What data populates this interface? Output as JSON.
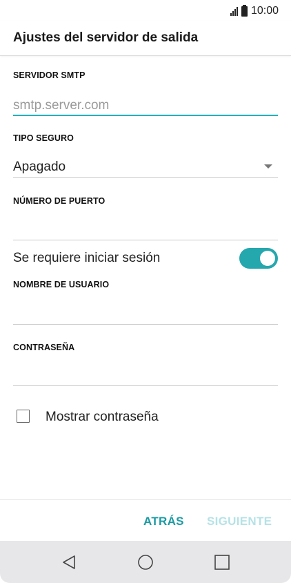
{
  "status_bar": {
    "time": "10:00"
  },
  "header": {
    "title": "Ajustes del servidor de salida"
  },
  "form": {
    "smtp_server": {
      "label": "SERVIDOR SMTP",
      "value": "",
      "placeholder": "smtp.server.com"
    },
    "security_type": {
      "label": "TIPO SEGURO",
      "value": "Apagado"
    },
    "port_number": {
      "label": "NÚMERO DE PUERTO",
      "value": ""
    },
    "login_required": {
      "label": "Se requiere iniciar sesión",
      "enabled": true
    },
    "username": {
      "label": "NOMBRE DE USUARIO",
      "value": ""
    },
    "password": {
      "label": "CONTRASEÑA",
      "value": ""
    },
    "show_password": {
      "label": "Mostrar contraseña",
      "checked": false
    }
  },
  "footer": {
    "back_label": "ATRÁS",
    "next_label": "SIGUIENTE"
  },
  "navigation": {
    "icons": [
      "back-icon",
      "home-icon",
      "recent-apps-icon"
    ]
  },
  "colors": {
    "accent": "#25a7ae",
    "accent_dark": "#1c9aa3",
    "disabled_text": "#b6e2e6",
    "nav_bar_bg": "#e7e7e9"
  }
}
